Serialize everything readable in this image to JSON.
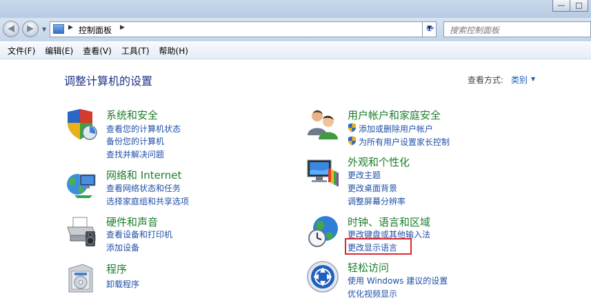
{
  "window": {
    "minimize_glyph": "—",
    "maximize_glyph": "□"
  },
  "nav": {
    "back_glyph": "◀",
    "forward_glyph": "▶",
    "breadcrumb": "控制面板",
    "search_placeholder": "搜索控制面板"
  },
  "menu": [
    {
      "label": "文件(F)"
    },
    {
      "label": "编辑(E)"
    },
    {
      "label": "查看(V)"
    },
    {
      "label": "工具(T)"
    },
    {
      "label": "帮助(H)"
    }
  ],
  "content": {
    "title": "调整计算机的设置",
    "view_by_label": "查看方式:",
    "view_by_value": "类别"
  },
  "categories": {
    "system": {
      "title": "系统和安全",
      "icon": "shield-chart-icon",
      "links": [
        "查看您的计算机状态",
        "备份您的计算机",
        "查找并解决问题"
      ]
    },
    "network": {
      "title": "网络和 Internet",
      "icon": "globe-network-icon",
      "links": [
        "查看网络状态和任务",
        "选择家庭组和共享选项"
      ]
    },
    "hardware": {
      "title": "硬件和声音",
      "icon": "printer-icon",
      "links": [
        "查看设备和打印机",
        "添加设备"
      ]
    },
    "programs": {
      "title": "程序",
      "icon": "program-box-icon",
      "links": [
        "卸载程序"
      ]
    },
    "users": {
      "title": "用户帐户和家庭安全",
      "icon": "users-icon",
      "links": [
        "添加或删除用户帐户",
        "为所有用户设置家长控制"
      ]
    },
    "appearance": {
      "title": "外观和个性化",
      "icon": "monitor-palette-icon",
      "links": [
        "更改主题",
        "更改桌面背景",
        "调整屏幕分辨率"
      ]
    },
    "clock": {
      "title": "时钟、语言和区域",
      "icon": "globe-clock-icon",
      "links": [
        "更改键盘或其他输入法",
        "更改显示语言"
      ]
    },
    "ease": {
      "title": "轻松访问",
      "icon": "ease-of-access-icon",
      "links": [
        "使用 Windows 建议的设置",
        "优化视频显示"
      ]
    }
  },
  "colors": {
    "title_blue": "#1e3287",
    "category_green": "#1b7d2a",
    "link_blue": "#1f4fa8",
    "highlight_red": "#e0262d"
  }
}
